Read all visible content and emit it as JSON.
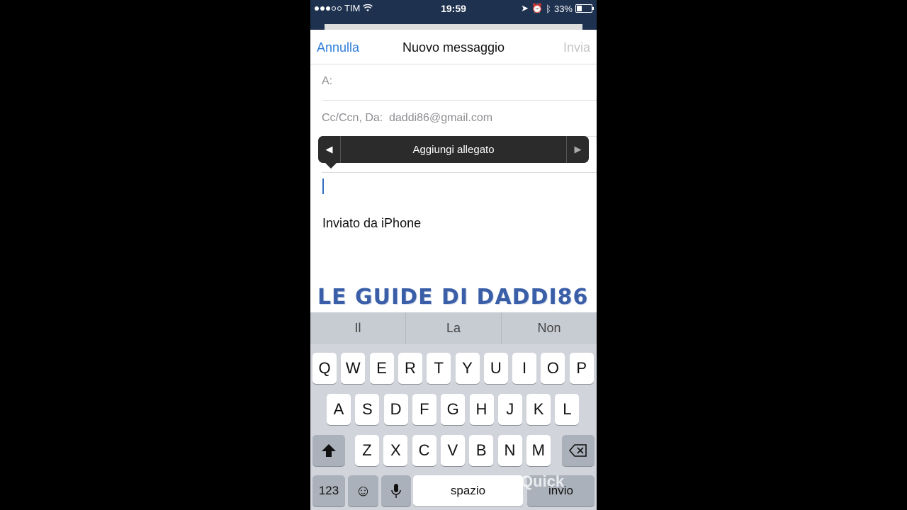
{
  "status": {
    "carrier": "TIM",
    "time": "19:59",
    "battery": "33%",
    "battery_level": 0.33,
    "signal_bars": 3,
    "signal_total": 5
  },
  "navbar": {
    "cancel": "Annulla",
    "title": "Nuovo messaggio",
    "send": "Invia"
  },
  "fields": {
    "to_label": "A:",
    "cc_label": "Cc/Ccn, Da:",
    "from_value": "daddi86@gmail.com"
  },
  "popup": {
    "label": "Aggiungi allegato",
    "left_arrow": "◀",
    "right_arrow": "▶"
  },
  "body": {
    "signature": "Inviato da iPhone"
  },
  "watermark": "LE GUIDE DI DADDI86",
  "keyboard": {
    "suggestions": [
      "Il",
      "La",
      "Non"
    ],
    "row1": [
      "Q",
      "W",
      "E",
      "R",
      "T",
      "Y",
      "U",
      "I",
      "O",
      "P"
    ],
    "row2": [
      "A",
      "S",
      "D",
      "F",
      "G",
      "H",
      "J",
      "K",
      "L"
    ],
    "row3": [
      "Z",
      "X",
      "C",
      "V",
      "B",
      "N",
      "M"
    ],
    "numbers_key": "123",
    "space_key": "spazio",
    "return_key": "invio"
  },
  "overlay": {
    "quick": "Quick"
  }
}
